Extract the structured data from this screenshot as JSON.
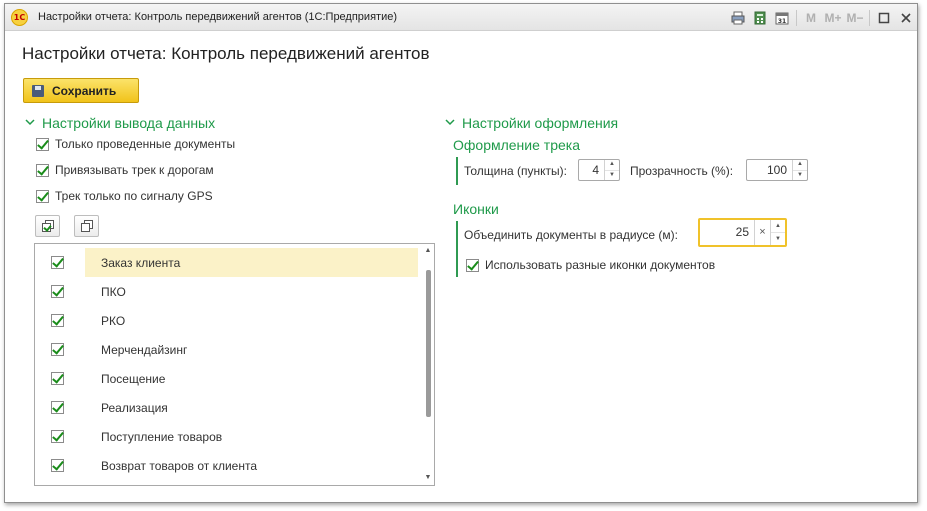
{
  "window": {
    "logo_text": "1С",
    "title": "Настройки отчета: Контроль передвижений агентов  (1С:Предприятие)",
    "buttons": {
      "m": "M",
      "m_plus": "M+",
      "m_minus": "M−"
    }
  },
  "page": {
    "title": "Настройки отчета: Контроль передвижений агентов"
  },
  "toolbar": {
    "save_label": "Сохранить"
  },
  "data_output": {
    "header": "Настройки вывода данных",
    "options": [
      {
        "label": "Только проведенные документы",
        "checked": true
      },
      {
        "label": "Привязывать трек к дорогам",
        "checked": true
      },
      {
        "label": "Трек только по сигналу GPS",
        "checked": true
      }
    ],
    "documents": [
      {
        "label": "Заказ клиента",
        "checked": true,
        "selected": true
      },
      {
        "label": "ПКО",
        "checked": true
      },
      {
        "label": "РКО",
        "checked": true
      },
      {
        "label": "Мерчендайзинг",
        "checked": true
      },
      {
        "label": "Посещение",
        "checked": true
      },
      {
        "label": "Реализация",
        "checked": true
      },
      {
        "label": "Поступление товаров",
        "checked": true
      },
      {
        "label": "Возврат товаров от клиента",
        "checked": true
      }
    ]
  },
  "appearance": {
    "header": "Настройки оформления",
    "track": {
      "title": "Оформление трека",
      "thickness_label": "Толщина (пункты):",
      "thickness_value": "4",
      "transparency_label": "Прозрачность (%):",
      "transparency_value": "100"
    },
    "icons": {
      "title": "Иконки",
      "merge_label": "Объединить документы в радиусе (м):",
      "merge_value": "25",
      "clear_symbol": "×",
      "use_different_icons_label": "Использовать разные иконки документов",
      "use_different_icons_checked": true
    }
  },
  "colors": {
    "accent_green": "#1f9a4a",
    "save_button": "#f1c31a",
    "selected_row": "#fbf2c8",
    "focus_border": "#f0c22a"
  }
}
